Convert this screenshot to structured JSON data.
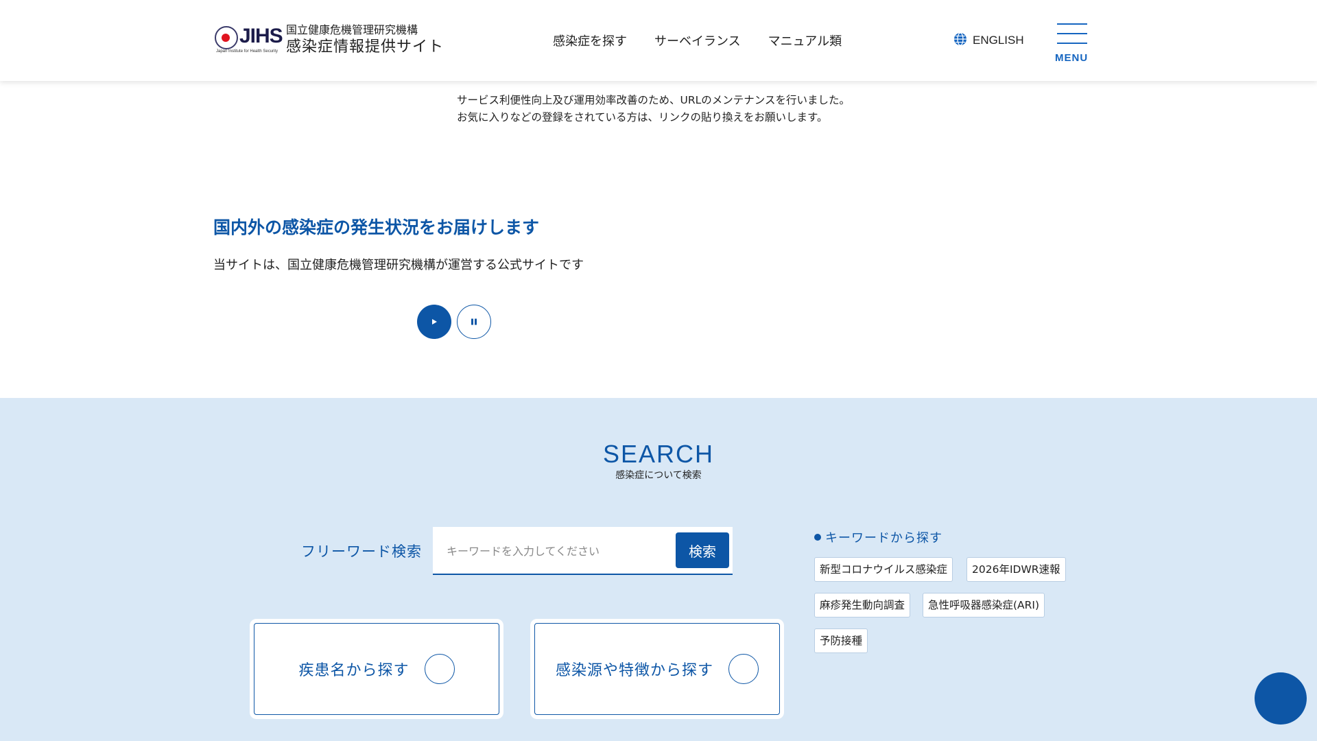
{
  "header": {
    "logo_text": "JIHS",
    "logo_subtext": "Japan Institute for Health Security",
    "org_name": "国立健康危機管理研究機構",
    "site_name": "感染症情報提供サイト",
    "nav": [
      "感染症を探す",
      "サーベイランス",
      "マニュアル類"
    ],
    "language_label": "ENGLISH",
    "menu_label": "MENU"
  },
  "notice": {
    "line1": "サービス利便性向上及び運用効率改善のため、URLのメンテナンスを行いました。",
    "line2": "お気に入りなどの登録をされている方は、リンクの貼り換えをお願いします。"
  },
  "hero": {
    "title": "国内外の感染症の発生状況をお届けします",
    "description": "当サイトは、国立健康危機管理研究機構が運営する公式サイトです"
  },
  "search": {
    "heading_en": "SEARCH",
    "heading_ja": "感染症について検索",
    "freeword_label": "フリーワード検索",
    "input_placeholder": "キーワードを入力してください",
    "input_value": "",
    "submit_label": "検索",
    "category_cards": [
      "疾患名から探す",
      "感染源や特徴から探す"
    ],
    "keyword_title": "キーワードから探す",
    "keywords": [
      "新型コロナウイルス感染症",
      "2026年IDWR速報",
      "麻疹発生動向調査",
      "急性呼吸器感染症(ARI)",
      "予防接種"
    ]
  },
  "colors": {
    "brand_blue": "#0d56a6",
    "section_bg": "#d9e8f6",
    "logo_red": "#e0141f"
  }
}
